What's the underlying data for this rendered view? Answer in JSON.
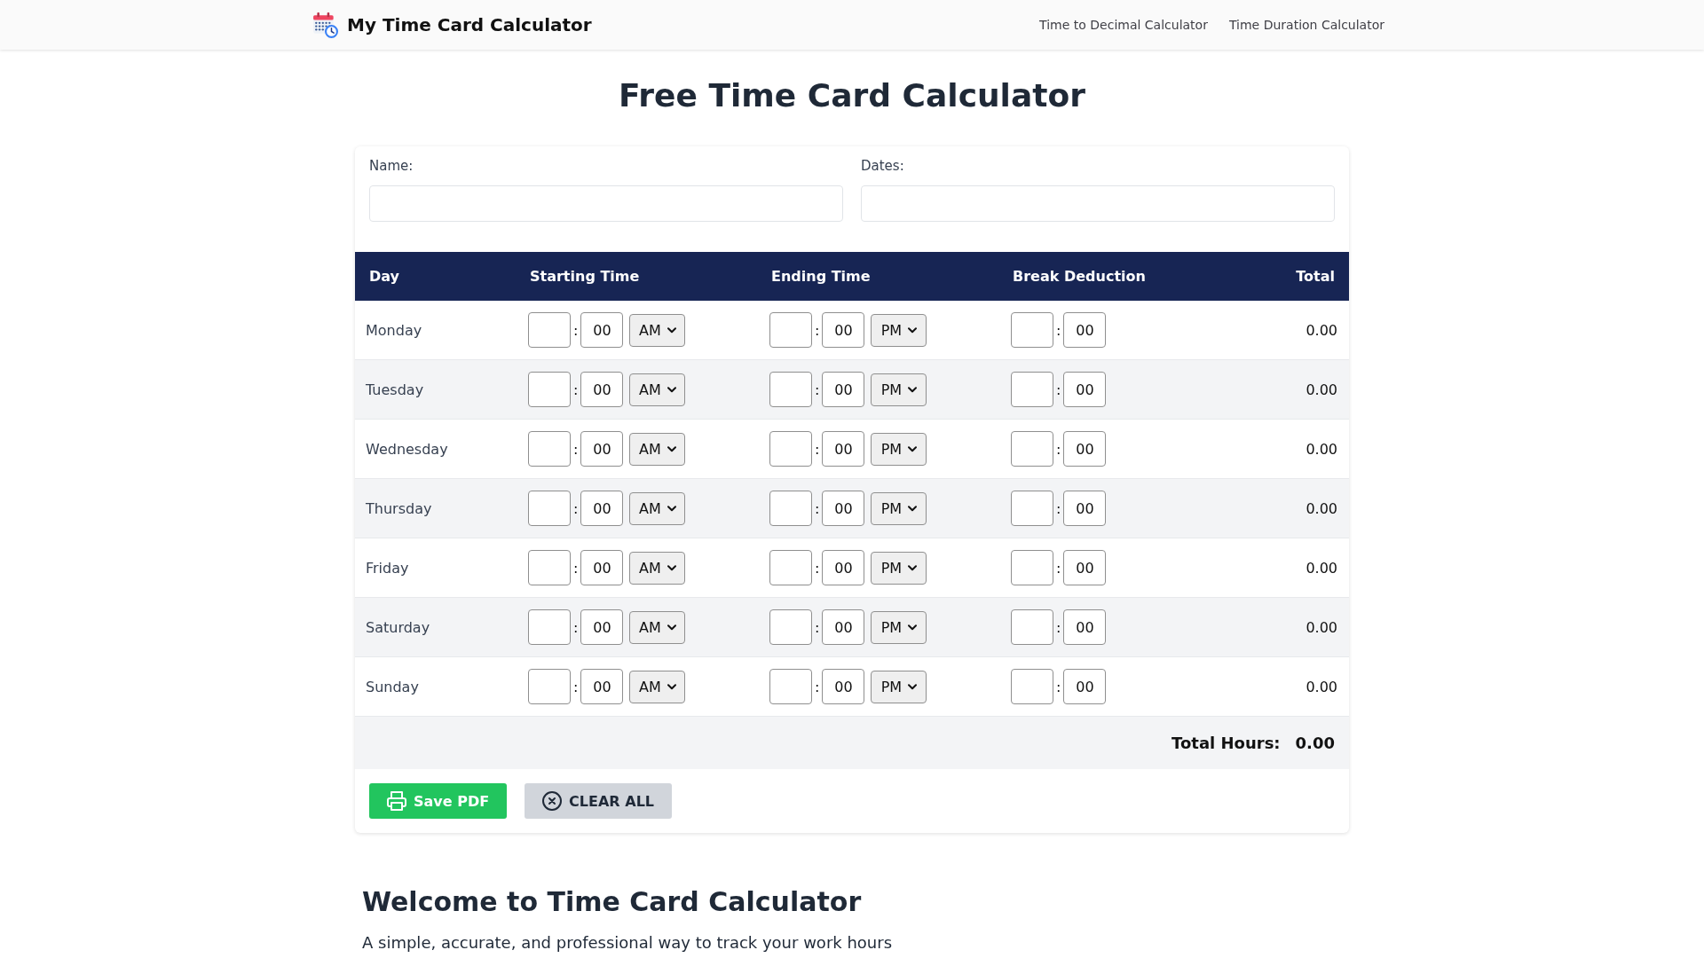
{
  "header": {
    "site_title": "My Time Card Calculator",
    "nav_links": [
      "Time to Decimal Calculator",
      "Time Duration Calculator"
    ]
  },
  "page_title": "Free Time Card Calculator",
  "form": {
    "fields": [
      {
        "label": "Name:"
      },
      {
        "label": "Dates:"
      }
    ]
  },
  "table": {
    "columns": [
      "Day",
      "Starting Time",
      "Ending Time",
      "Break Deduction",
      "Total"
    ],
    "rows": [
      {
        "day": "Monday",
        "start": {
          "separator": ":",
          "minute": "00",
          "period": "AM"
        },
        "end": {
          "separator": ":",
          "minute": "00",
          "period": "PM"
        },
        "break": {
          "separator": ":",
          "minute": "00"
        },
        "total": "0.00"
      },
      {
        "day": "Tuesday",
        "start": {
          "separator": ":",
          "minute": "00",
          "period": "AM"
        },
        "end": {
          "separator": ":",
          "minute": "00",
          "period": "PM"
        },
        "break": {
          "separator": ":",
          "minute": "00"
        },
        "total": "0.00"
      },
      {
        "day": "Wednesday",
        "start": {
          "separator": ":",
          "minute": "00",
          "period": "AM"
        },
        "end": {
          "separator": ":",
          "minute": "00",
          "period": "PM"
        },
        "break": {
          "separator": ":",
          "minute": "00"
        },
        "total": "0.00"
      },
      {
        "day": "Thursday",
        "start": {
          "separator": ":",
          "minute": "00",
          "period": "AM"
        },
        "end": {
          "separator": ":",
          "minute": "00",
          "period": "PM"
        },
        "break": {
          "separator": ":",
          "minute": "00"
        },
        "total": "0.00"
      },
      {
        "day": "Friday",
        "start": {
          "separator": ":",
          "minute": "00",
          "period": "AM"
        },
        "end": {
          "separator": ":",
          "minute": "00",
          "period": "PM"
        },
        "break": {
          "separator": ":",
          "minute": "00"
        },
        "total": "0.00"
      },
      {
        "day": "Saturday",
        "start": {
          "separator": ":",
          "minute": "00",
          "period": "AM"
        },
        "end": {
          "separator": ":",
          "minute": "00",
          "period": "PM"
        },
        "break": {
          "separator": ":",
          "minute": "00"
        },
        "total": "0.00"
      },
      {
        "day": "Sunday",
        "start": {
          "separator": ":",
          "minute": "00",
          "period": "AM"
        },
        "end": {
          "separator": ":",
          "minute": "00",
          "period": "PM"
        },
        "break": {
          "separator": ":",
          "minute": "00"
        },
        "total": "0.00"
      }
    ]
  },
  "total_hours": {
    "label": "Total Hours:",
    "value": "0.00"
  },
  "buttons": [
    {
      "kind": "save",
      "label": "Save PDF"
    },
    {
      "kind": "clear",
      "label": "CLEAR ALL"
    }
  ],
  "intro": {
    "heading": "Welcome to Time Card Calculator",
    "text": "A simple, accurate, and professional way to track your work hours"
  }
}
